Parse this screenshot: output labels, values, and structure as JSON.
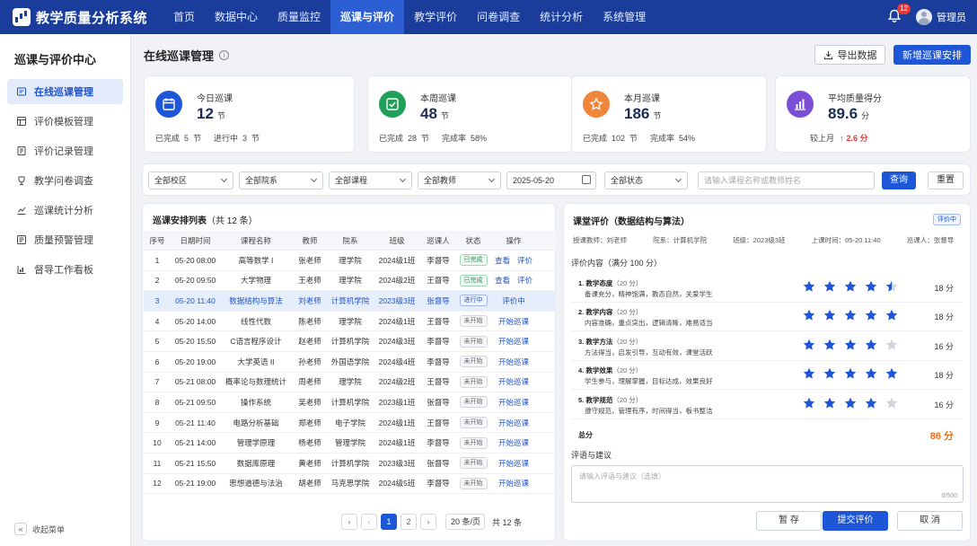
{
  "app": {
    "title": "教学质量分析系统"
  },
  "nav": [
    {
      "label": "首页"
    },
    {
      "label": "数据中心"
    },
    {
      "label": "质量监控"
    },
    {
      "label": "巡课与评价",
      "active": true
    },
    {
      "label": "教学评价"
    },
    {
      "label": "问卷调查"
    },
    {
      "label": "统计分析"
    },
    {
      "label": "系统管理"
    }
  ],
  "notifications": {
    "count": "12"
  },
  "user": {
    "name": "管理员"
  },
  "sidebar": {
    "title": "巡课与评价中心",
    "items": [
      {
        "label": "在线巡课管理",
        "icon": "monitor-icon",
        "active": true
      },
      {
        "label": "评价模板管理",
        "icon": "template-icon"
      },
      {
        "label": "评价记录管理",
        "icon": "record-icon"
      },
      {
        "label": "教学问卷调查",
        "icon": "survey-icon"
      },
      {
        "label": "巡课统计分析",
        "icon": "chart-icon"
      },
      {
        "label": "质量预警管理",
        "icon": "warning-icon"
      },
      {
        "label": "督导工作看板",
        "icon": "dashboard-icon"
      }
    ],
    "collapse_label": "收起菜单"
  },
  "page": {
    "title": "在线巡课管理",
    "export_label": "导出数据",
    "new_label": "新增巡课安排"
  },
  "stats": [
    {
      "label": "今日巡课",
      "value": "12",
      "unit": "节",
      "foot1": "已完成  5  节",
      "foot2": "进行中  3  节",
      "color": "#1e56d8",
      "icon": "calendar-icon"
    },
    {
      "label": "本周巡课",
      "value": "48",
      "unit": "节",
      "foot1": "已完成  28  节",
      "foot2": "完成率  58%",
      "color": "#21a05a",
      "icon": "check-icon"
    },
    {
      "label": "本月巡课",
      "value": "186",
      "unit": "节",
      "foot1": "已完成  102  节",
      "foot2": "完成率  54%",
      "color": "#f0863a",
      "icon": "star-icon"
    },
    {
      "label": "平均质量得分",
      "value": "89.6",
      "unit": "分",
      "foot1": "较上月",
      "foot2": "2.6 分",
      "color": "#7a4fd6",
      "icon": "bar-chart-icon"
    }
  ],
  "filters": {
    "campus": "全部校区",
    "department": "全部院系",
    "course": "全部课程",
    "teacher": "全部教师",
    "date": "2025-05-20",
    "status": "全部状态",
    "search_placeholder": "请输入课程名称或教师姓名",
    "query_label": "查询",
    "reset_label": "重置"
  },
  "list": {
    "title": "巡课安排列表",
    "count": "（共 12 条）",
    "columns": [
      "序号",
      "日期时间",
      "课程名称",
      "教师",
      "院系",
      "班级",
      "巡课人",
      "状态",
      "操作"
    ],
    "rows": [
      {
        "no": "1",
        "time": "05-20 08:00",
        "course": "高等数学 I",
        "teacher": "张老师",
        "dept": "理学院",
        "cls": "2024级1班",
        "inspector": "李督导",
        "status": "已完成",
        "st": "done",
        "op1": "查看",
        "op2": "评价"
      },
      {
        "no": "2",
        "time": "05-20 09:50",
        "course": "大学物理",
        "teacher": "王老师",
        "dept": "理学院",
        "cls": "2024级2班",
        "inspector": "王督导",
        "status": "已完成",
        "st": "done",
        "op1": "查看",
        "op2": "评价"
      },
      {
        "no": "3",
        "time": "05-20 11:40",
        "course": "数据结构与算法",
        "teacher": "刘老师",
        "dept": "计算机学院",
        "cls": "2023级3班",
        "inspector": "张督导",
        "status": "进行中",
        "st": "prog",
        "op1": "评价中",
        "op2": "",
        "selected": true
      },
      {
        "no": "4",
        "time": "05-20 14:00",
        "course": "线性代数",
        "teacher": "陈老师",
        "dept": "理学院",
        "cls": "2024级1班",
        "inspector": "王督导",
        "status": "未开始",
        "st": "todo",
        "op1": "开始巡课",
        "op2": ""
      },
      {
        "no": "5",
        "time": "05-20 15:50",
        "course": "C语言程序设计",
        "teacher": "赵老师",
        "dept": "计算机学院",
        "cls": "2024级3班",
        "inspector": "李督导",
        "status": "未开始",
        "st": "todo",
        "op1": "开始巡课",
        "op2": ""
      },
      {
        "no": "6",
        "time": "05-20 19:00",
        "course": "大学英语 II",
        "teacher": "孙老师",
        "dept": "外国语学院",
        "cls": "2024级4班",
        "inspector": "李督导",
        "status": "未开始",
        "st": "todo",
        "op1": "开始巡课",
        "op2": ""
      },
      {
        "no": "7",
        "time": "05-21 08:00",
        "course": "概率论与数理统计",
        "teacher": "周老师",
        "dept": "理学院",
        "cls": "2024级2班",
        "inspector": "王督导",
        "status": "未开始",
        "st": "todo",
        "op1": "开始巡课",
        "op2": ""
      },
      {
        "no": "8",
        "time": "05-21 09:50",
        "course": "操作系统",
        "teacher": "吴老师",
        "dept": "计算机学院",
        "cls": "2023级1班",
        "inspector": "张督导",
        "status": "未开始",
        "st": "todo",
        "op1": "开始巡课",
        "op2": ""
      },
      {
        "no": "9",
        "time": "05-21 11:40",
        "course": "电路分析基础",
        "teacher": "郑老师",
        "dept": "电子学院",
        "cls": "2024级1班",
        "inspector": "王督导",
        "status": "未开始",
        "st": "todo",
        "op1": "开始巡课",
        "op2": ""
      },
      {
        "no": "10",
        "time": "05-21 14:00",
        "course": "管理学原理",
        "teacher": "杨老师",
        "dept": "管理学院",
        "cls": "2024级1班",
        "inspector": "李督导",
        "status": "未开始",
        "st": "todo",
        "op1": "开始巡课",
        "op2": ""
      },
      {
        "no": "11",
        "time": "05-21 15:50",
        "course": "数据库原理",
        "teacher": "黄老师",
        "dept": "计算机学院",
        "cls": "2023级3班",
        "inspector": "张督导",
        "status": "未开始",
        "st": "todo",
        "op1": "开始巡课",
        "op2": ""
      },
      {
        "no": "12",
        "time": "05-21 19:00",
        "course": "思想道德与法治",
        "teacher": "胡老师",
        "dept": "马克思学院",
        "cls": "2024级5班",
        "inspector": "李督导",
        "status": "未开始",
        "st": "todo",
        "op1": "开始巡课",
        "op2": ""
      }
    ],
    "pagination": {
      "pages": [
        "1",
        "2"
      ],
      "current": "1",
      "page_size": "20 条/页",
      "total": "共 12 条"
    }
  },
  "evaluation": {
    "title": "课堂评价（数据结构与算法）",
    "badge": "评价中",
    "meta": {
      "teacher": "授课教师：刘老师",
      "dept": "院系：计算机学院",
      "cls": "班级：2023级3班",
      "time": "上课时间：05-20 11:40",
      "inspector": "巡课人：张督导"
    },
    "content_title": "评价内容（满分 100 分）",
    "criteria": [
      {
        "name": "1. 教学态度",
        "max": "（20 分）",
        "desc": "备课充分，精神饱满，教态自然，关爱学生",
        "rating": 4.5,
        "score": "18 分"
      },
      {
        "name": "2. 教学内容",
        "max": "（20 分）",
        "desc": "内容准确，重点突出，逻辑清晰，难易适当",
        "rating": 5,
        "score": "18 分"
      },
      {
        "name": "3. 教学方法",
        "max": "（20 分）",
        "desc": "方法得当，启发引导，互动有效，课堂活跃",
        "rating": 4,
        "score": "16 分"
      },
      {
        "name": "4. 教学效果",
        "max": "（20 分）",
        "desc": "学生参与，理解掌握，目标达成，效果良好",
        "rating": 5,
        "score": "18 分"
      },
      {
        "name": "5. 教学规范",
        "max": "（20 分）",
        "desc": "遵守规范，管理有序，时间得当，板书整洁",
        "rating": 4,
        "score": "16 分"
      }
    ],
    "total_label": "总分",
    "total_value": "86 分",
    "comment_title": "评语与建议",
    "comment_placeholder": "请输入评语与建议（选填）",
    "comment_count": "0/500",
    "save_label": "暂 存",
    "submit_label": "提交评价",
    "cancel_label": "取 消"
  },
  "colors": {
    "primary": "#1e56d8",
    "topbar": "#1a3d9c",
    "star": "#1e56d8",
    "star_empty": "#d0d4dc",
    "total": "#f0701a",
    "up": "#e53935"
  }
}
